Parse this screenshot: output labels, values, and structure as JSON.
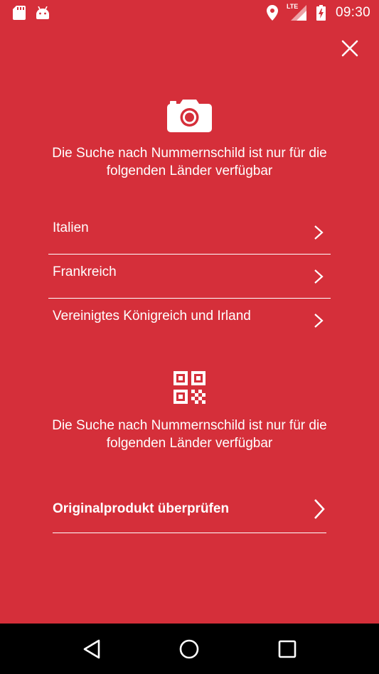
{
  "status_bar": {
    "time": "09:30",
    "network": "LTE",
    "icons": [
      "sd-card-icon",
      "android-icon",
      "location-icon",
      "signal-icon",
      "battery-charging-icon"
    ]
  },
  "close": {
    "icon": "close-icon"
  },
  "plate_section": {
    "icon": "camera-icon",
    "text_line1": "Die Suche nach Nummernschild ist nur für die",
    "text_line2": "folgenden Länder verfügbar",
    "countries": [
      {
        "label": "Italien"
      },
      {
        "label": "Frankreich"
      },
      {
        "label": "Vereinigtes Königreich und Irland"
      }
    ]
  },
  "qr_section": {
    "icon": "qr-code-icon",
    "text_line1": "Die Suche nach Nummernschild ist nur für die",
    "text_line2": "folgenden Länder verfügbar",
    "action_label": "Originalprodukt überprüfen"
  },
  "nav_bar": {
    "icons": [
      "back-icon",
      "home-icon",
      "recents-icon"
    ]
  },
  "colors": {
    "background": "#d52f3a",
    "foreground": "#ffffff",
    "nav_background": "#000000"
  }
}
